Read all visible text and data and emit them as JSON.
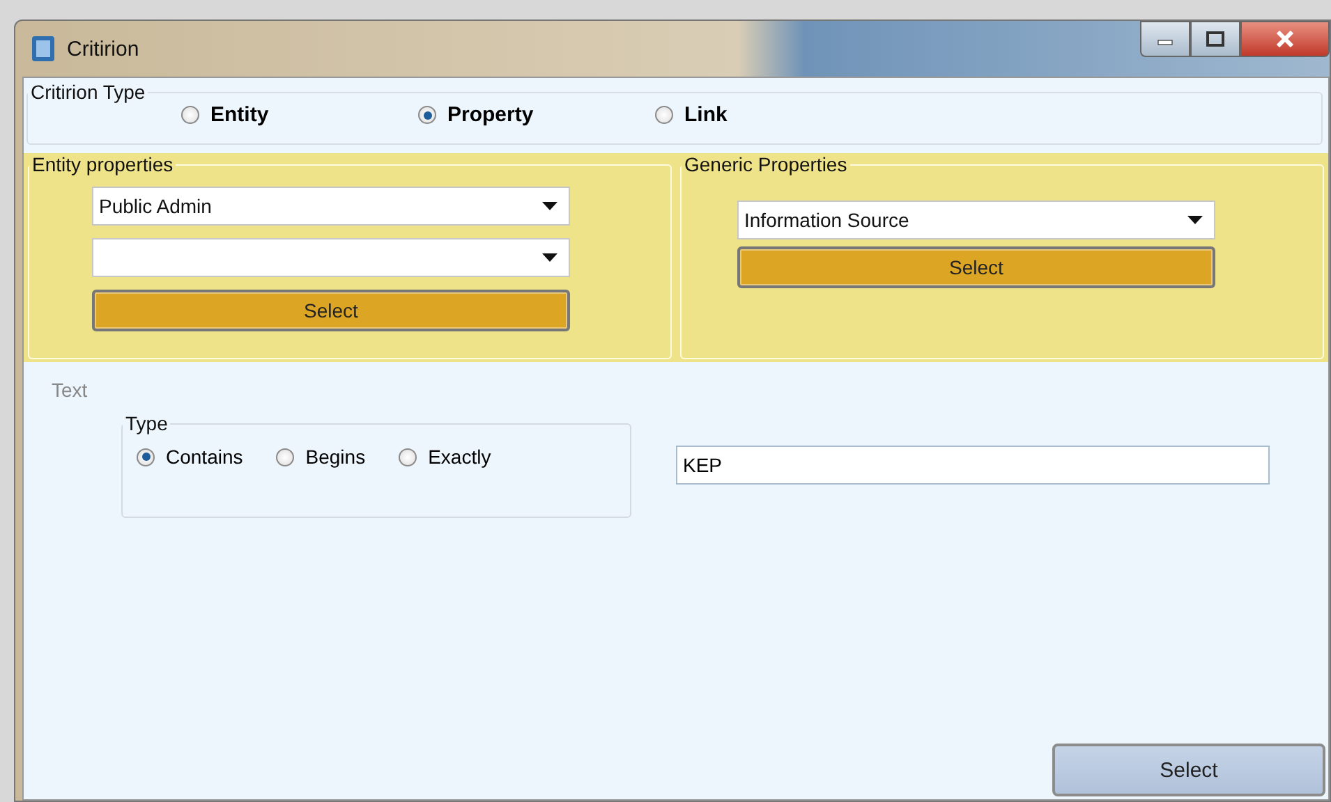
{
  "window": {
    "title": "Critirion"
  },
  "criterion_type": {
    "label": "Critirion Type",
    "options": [
      {
        "label": "Entity",
        "selected": false
      },
      {
        "label": "Property",
        "selected": true
      },
      {
        "label": "Link",
        "selected": false
      }
    ]
  },
  "entity_properties": {
    "label": "Entity properties",
    "dropdowns": [
      {
        "value": "Public Admin"
      }
    ],
    "button": "Select"
  },
  "generic_properties": {
    "label": "Generic Properties",
    "dropdowns": [
      {
        "value": "Information Source"
      }
    ],
    "button": "Select"
  },
  "text": {
    "label": "Text",
    "type": {
      "label": "Type",
      "options": [
        {
          "label": "Contains",
          "selected": true
        },
        {
          "label": "Begins",
          "selected": false
        },
        {
          "label": "Exactly",
          "selected": false
        }
      ]
    },
    "input": {
      "value": "KEP"
    }
  },
  "footer_button": "Select"
}
